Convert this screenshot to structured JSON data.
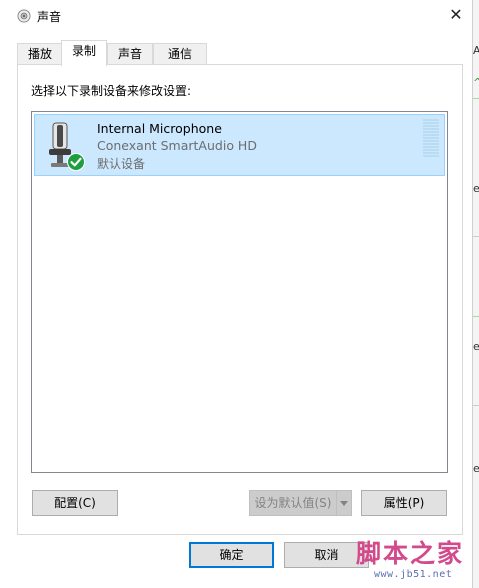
{
  "window": {
    "title": "声音",
    "close_glyph": "✕"
  },
  "tabs": [
    {
      "label": "播放",
      "active": false
    },
    {
      "label": "录制",
      "active": true
    },
    {
      "label": "声音",
      "active": false
    },
    {
      "label": "通信",
      "active": false
    }
  ],
  "panel": {
    "instruction": "选择以下录制设备来修改设置:"
  },
  "devices": [
    {
      "name": "Internal Microphone",
      "driver": "Conexant SmartAudio HD",
      "status": "默认设备",
      "icon": "microphone-icon",
      "default_badge": "check-icon",
      "selected": true
    }
  ],
  "buttons": {
    "configure": "配置(C)",
    "set_default": "设为默认值(S)",
    "properties": "属性(P)",
    "ok": "确定",
    "cancel": "取消"
  },
  "watermark": {
    "text": "脚本之家",
    "url": "www.jb51.net"
  },
  "background": {
    "glyphs": [
      "A",
      "f",
      "^",
      "e",
      "e",
      "e"
    ]
  },
  "colors": {
    "selection": "#cce8ff",
    "selection_border": "#99d1ff",
    "accent": "#0078d7",
    "check": "#1e9e3f"
  }
}
